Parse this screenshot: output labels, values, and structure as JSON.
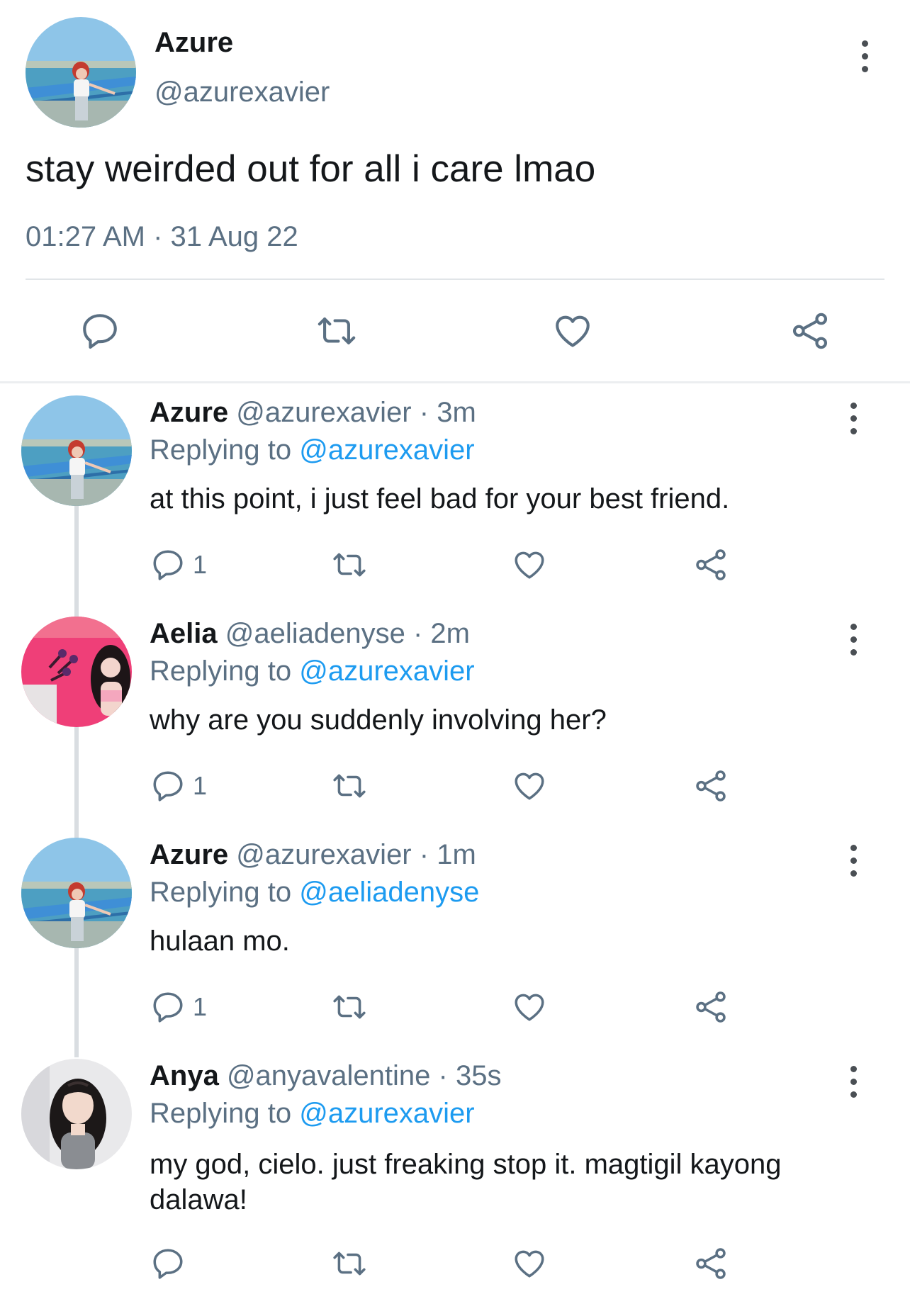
{
  "main_tweet": {
    "name": "Azure",
    "handle": "@azurexavier",
    "text": "stay weirded out for all i care lmao",
    "timestamp": "01:27 AM · 31 Aug 22"
  },
  "replies": [
    {
      "name": "Azure",
      "handle": "@azurexavier",
      "time": "· 3m",
      "replying_label": "Replying to",
      "replying_to": "@azurexavier",
      "text": "at this point, i just feel bad for your best friend.",
      "reply_count": "1"
    },
    {
      "name": "Aelia",
      "handle": "@aeliadenyse",
      "time": "· 2m",
      "replying_label": "Replying to",
      "replying_to": "@azurexavier",
      "text": "why are you suddenly involving her?",
      "reply_count": "1"
    },
    {
      "name": "Azure",
      "handle": "@azurexavier",
      "time": "· 1m",
      "replying_label": "Replying to",
      "replying_to": "@aeliadenyse",
      "text": "hulaan mo.",
      "reply_count": "1"
    },
    {
      "name": "Anya",
      "handle": "@anyavalentine",
      "time": "· 35s",
      "replying_label": "Replying to",
      "replying_to": "@azurexavier",
      "text": "my god, cielo. just freaking stop it. magtigil kayong dalawa!",
      "reply_count": ""
    }
  ],
  "icons": {
    "reply": "reply-icon",
    "retweet": "retweet-icon",
    "like": "heart-icon",
    "share": "share-icon",
    "more": "more-icon"
  },
  "colors": {
    "link": "#1d9bf0",
    "muted": "#5b7083",
    "text": "#14171a"
  }
}
